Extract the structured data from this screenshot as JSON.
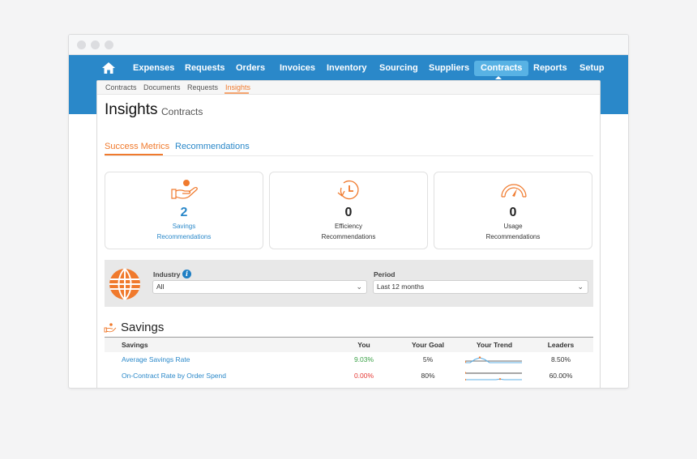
{
  "nav": {
    "home_icon": "home-icon",
    "items": [
      {
        "label": "Expenses",
        "active": false
      },
      {
        "label": "Requests",
        "active": false
      },
      {
        "label": "Orders",
        "active": false
      },
      {
        "label": "Invoices",
        "active": false
      },
      {
        "label": "Inventory",
        "active": false
      },
      {
        "label": "Sourcing",
        "active": false
      },
      {
        "label": "Suppliers",
        "active": false
      },
      {
        "label": "Contracts",
        "active": true
      },
      {
        "label": "Reports",
        "active": false
      },
      {
        "label": "Setup",
        "active": false
      }
    ]
  },
  "subnav": {
    "items": [
      {
        "label": "Contracts",
        "active": false
      },
      {
        "label": "Documents",
        "active": false
      },
      {
        "label": "Requests",
        "active": false
      },
      {
        "label": "Insights",
        "active": true
      }
    ]
  },
  "page": {
    "title": "Insights",
    "subtitle": "Contracts"
  },
  "tabs": [
    {
      "label": "Success Metrics",
      "active": true
    },
    {
      "label": "Recommendations",
      "active": false
    }
  ],
  "metrics": [
    {
      "icon": "hand-coin-icon",
      "value": "2",
      "label1": "Savings",
      "label2": "Recommendations",
      "highlight": true
    },
    {
      "icon": "clock-refresh-icon",
      "value": "0",
      "label1": "Efficiency",
      "label2": "Recommendations",
      "highlight": false
    },
    {
      "icon": "gauge-icon",
      "value": "0",
      "label1": "Usage",
      "label2": "Recommendations",
      "highlight": false
    }
  ],
  "filters": {
    "industry": {
      "label": "Industry",
      "value": "All",
      "info_icon": "info-icon"
    },
    "period": {
      "label": "Period",
      "value": "Last 12 months"
    }
  },
  "savings": {
    "title": "Savings",
    "columns": [
      "Savings",
      "You",
      "Your Goal",
      "Your Trend",
      "Leaders"
    ],
    "rows": [
      {
        "name": "Average Savings Rate",
        "you": "9.03%",
        "you_status": "good",
        "goal": "5%",
        "leaders": "8.50%"
      },
      {
        "name": "On-Contract Rate by Order Spend",
        "you": "0.00%",
        "you_status": "bad",
        "goal": "80%",
        "leaders": "60.00%"
      }
    ]
  },
  "colors": {
    "brand_blue": "#2a88c9",
    "accent_orange": "#f07a2d",
    "good_green": "#3aa146",
    "bad_red": "#e53935"
  }
}
